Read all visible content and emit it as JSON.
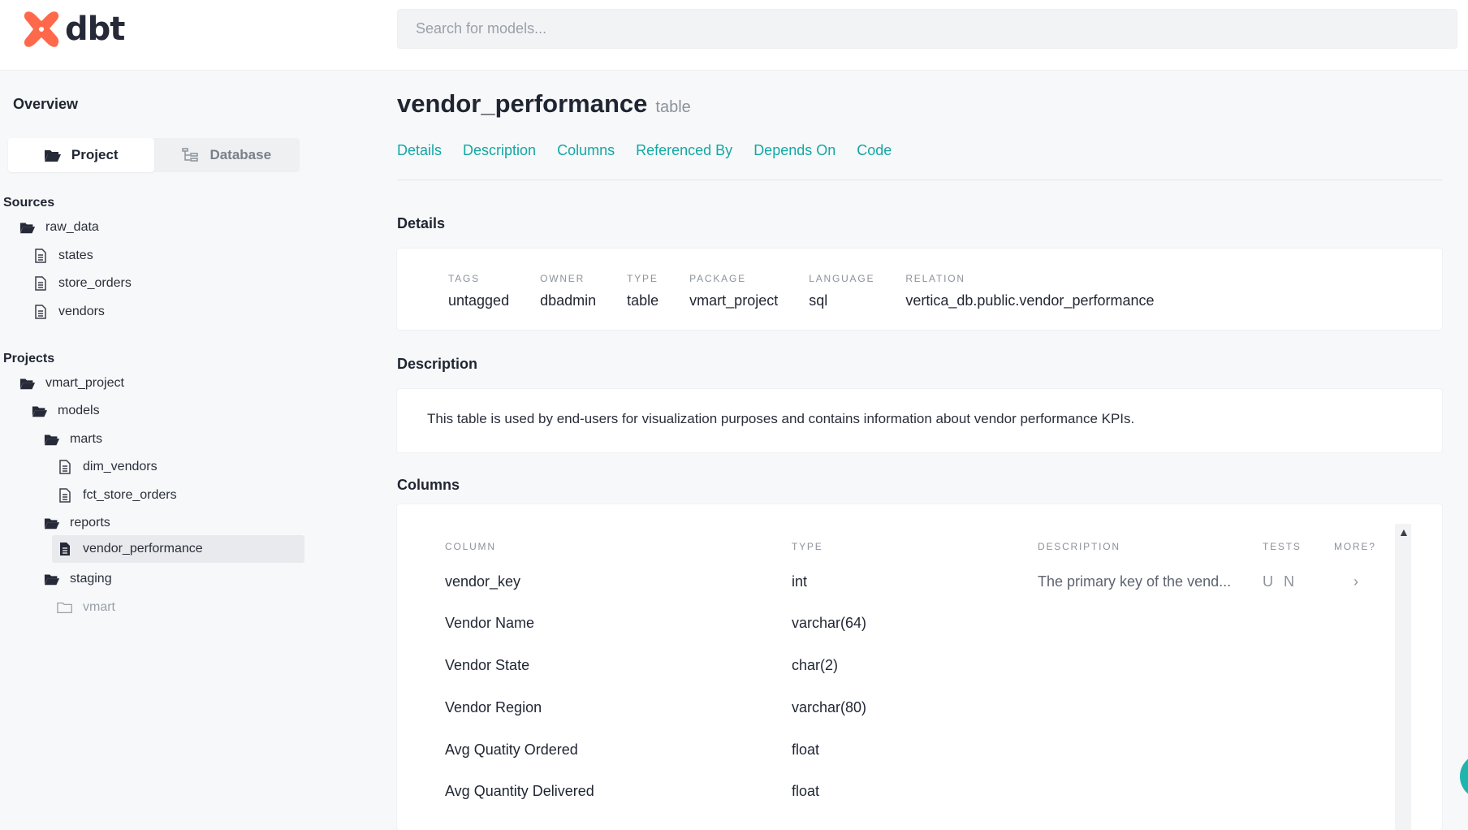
{
  "header": {
    "brand": "dbt",
    "search_placeholder": "Search for models..."
  },
  "sidebar": {
    "overview": "Overview",
    "toggle": {
      "project": "Project",
      "database": "Database"
    },
    "sources_title": "Sources",
    "projects_title": "Projects",
    "tree": [
      {
        "label": "raw_data",
        "icon": "folder-open-icon"
      },
      {
        "label": "states",
        "icon": "file-icon"
      },
      {
        "label": "store_orders",
        "icon": "file-icon"
      },
      {
        "label": "vendors",
        "icon": "file-icon"
      },
      {
        "label": "vmart_project",
        "icon": "folder-open-icon"
      },
      {
        "label": "models",
        "icon": "folder-open-icon"
      },
      {
        "label": "marts",
        "icon": "folder-open-icon"
      },
      {
        "label": "dim_vendors",
        "icon": "file-icon"
      },
      {
        "label": "fct_store_orders",
        "icon": "file-icon"
      },
      {
        "label": "reports",
        "icon": "folder-open-icon"
      },
      {
        "label": "vendor_performance",
        "icon": "file-icon"
      },
      {
        "label": "staging",
        "icon": "folder-open-icon"
      },
      {
        "label": "vmart",
        "icon": "folder-closed-icon"
      }
    ]
  },
  "model": {
    "name": "vendor_performance",
    "type": "table"
  },
  "tabs": [
    "Details",
    "Description",
    "Columns",
    "Referenced By",
    "Depends On",
    "Code"
  ],
  "details": {
    "heading": "Details",
    "fields": [
      {
        "label": "TAGS",
        "value": "untagged"
      },
      {
        "label": "OWNER",
        "value": "dbadmin"
      },
      {
        "label": "TYPE",
        "value": "table"
      },
      {
        "label": "PACKAGE",
        "value": "vmart_project"
      },
      {
        "label": "LANGUAGE",
        "value": "sql"
      },
      {
        "label": "RELATION",
        "value": "vertica_db.public.vendor_performance"
      }
    ]
  },
  "description": {
    "heading": "Description",
    "text": "This table is used by end-users for visualization purposes and contains information about vendor performance KPIs."
  },
  "columns": {
    "heading": "Columns",
    "headers": [
      "COLUMN",
      "TYPE",
      "DESCRIPTION",
      "TESTS",
      "MORE?"
    ],
    "rows": [
      {
        "name": "vendor_key",
        "type": "int",
        "description": "The primary key of the vend...",
        "tests": "U N",
        "more": "›"
      },
      {
        "name": "Vendor Name",
        "type": "varchar(64)",
        "description": "",
        "tests": "",
        "more": ""
      },
      {
        "name": "Vendor State",
        "type": "char(2)",
        "description": "",
        "tests": "",
        "more": ""
      },
      {
        "name": "Vendor Region",
        "type": "varchar(80)",
        "description": "",
        "tests": "",
        "more": ""
      },
      {
        "name": "Avg Quatity Ordered",
        "type": "float",
        "description": "",
        "tests": "",
        "more": ""
      },
      {
        "name": "Avg Quantity Delivered",
        "type": "float",
        "description": "",
        "tests": "",
        "more": ""
      }
    ]
  },
  "colors": {
    "accent": "#12a8a5",
    "brand": "#ff694b"
  }
}
